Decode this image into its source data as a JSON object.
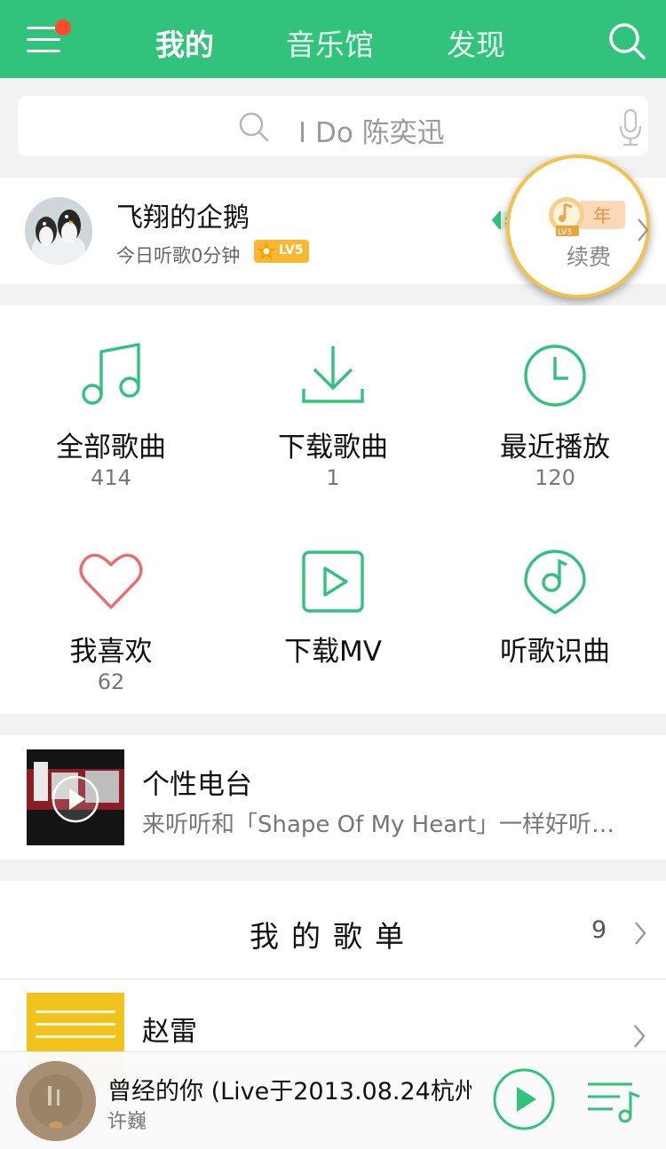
{
  "header": {
    "tabs": [
      {
        "label": "我的",
        "active": true
      },
      {
        "label": "音乐馆",
        "active": false
      },
      {
        "label": "发现",
        "active": false
      }
    ],
    "menu_icon": "hamburger-menu-icon",
    "notification_dot_color": "#ff4a2e",
    "search_icon": "search-icon",
    "brand_color": "#31c27c"
  },
  "search": {
    "placeholder": "I Do 陈奕迅",
    "mic_icon": "microphone-icon"
  },
  "profile": {
    "username": "飞翔的企鹅",
    "listen_today": "今日听歌0分钟",
    "level_badge": "LV5",
    "vip_badge_small": "年",
    "vip_badge_large": "年",
    "vip_level": "LV3",
    "renew_label": "续费"
  },
  "library": {
    "items": [
      {
        "label": "全部歌曲",
        "count": "414",
        "icon": "music-note-icon"
      },
      {
        "label": "下载歌曲",
        "count": "1",
        "icon": "download-icon"
      },
      {
        "label": "最近播放",
        "count": "120",
        "icon": "clock-icon"
      },
      {
        "label": "我喜欢",
        "count": "62",
        "icon": "heart-icon"
      },
      {
        "label": "下载MV",
        "count": "",
        "icon": "video-play-icon"
      },
      {
        "label": "听歌识曲",
        "count": "",
        "icon": "music-recognition-icon"
      }
    ],
    "accent_color": "#31c27c",
    "heart_color": "#ef6a6a"
  },
  "radio": {
    "title": "个性电台",
    "subtitle": "来听听和「Shape Of My Heart」一样好听…"
  },
  "playlists": {
    "title": "我的歌单",
    "count": "9",
    "items": [
      {
        "name": "赵雷"
      }
    ]
  },
  "player": {
    "song_title": "曾经的你 (Live于2013.08.24杭州",
    "artist": "许巍"
  }
}
